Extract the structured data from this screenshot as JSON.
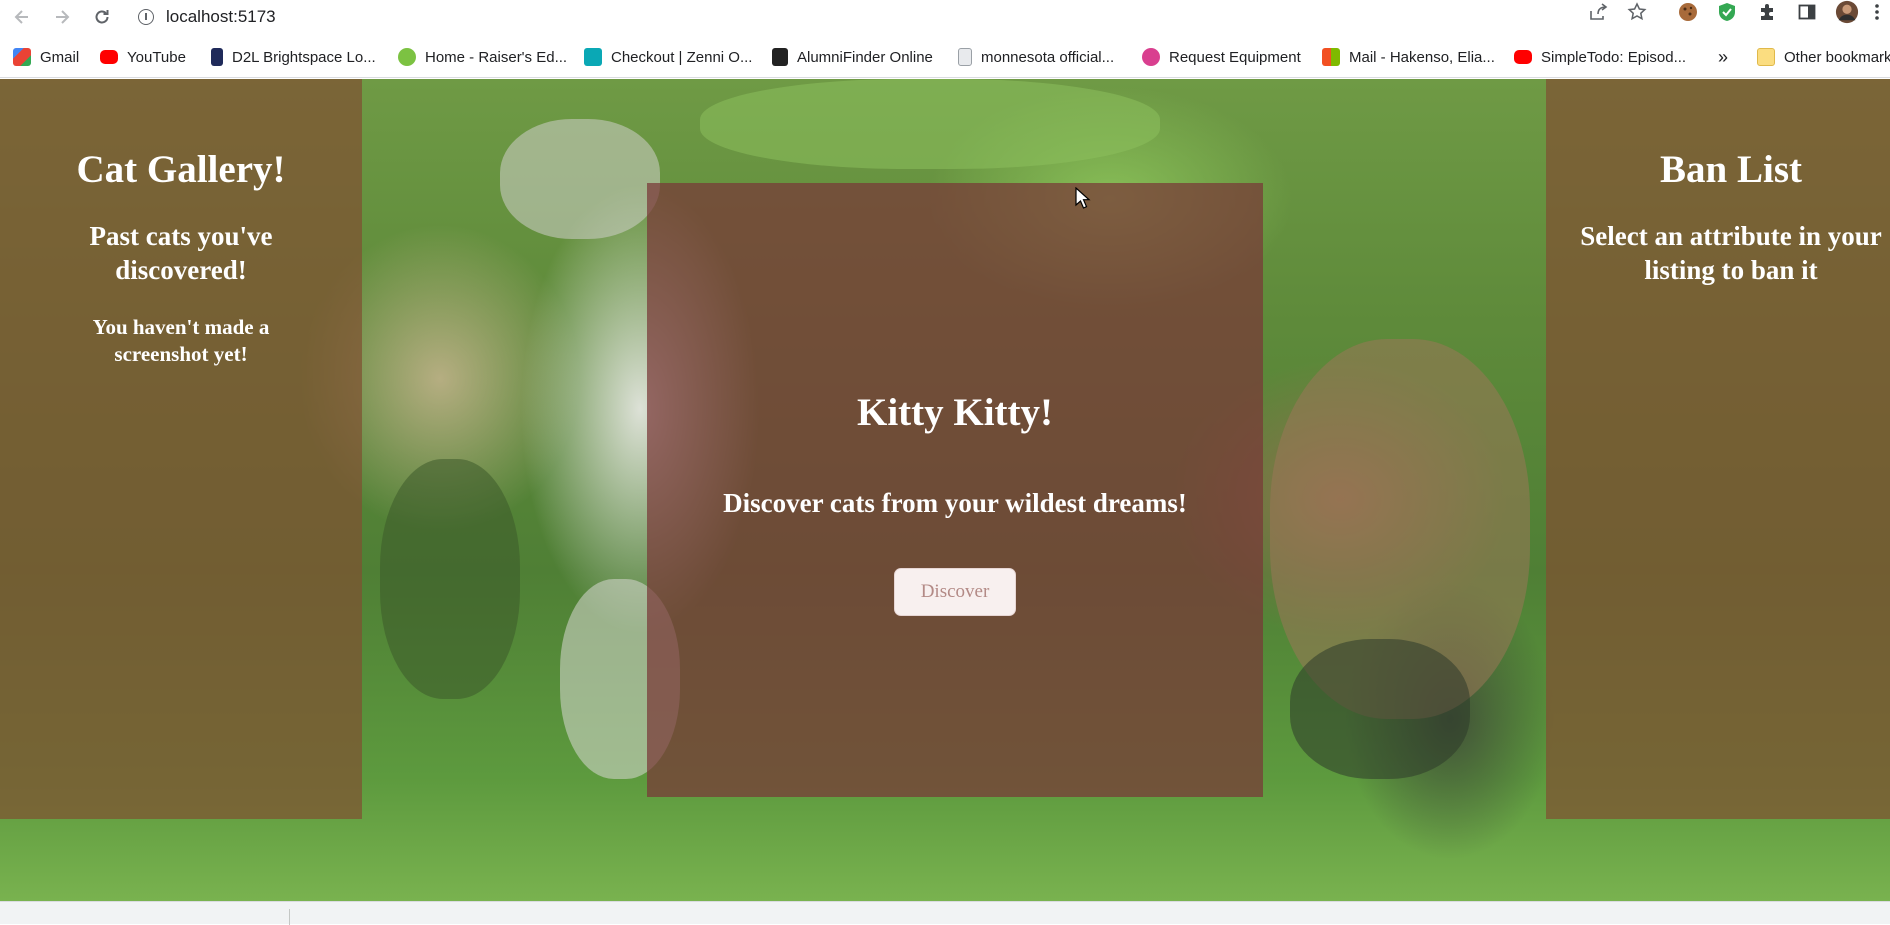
{
  "browser": {
    "url": "localhost:5173",
    "bookmarks": [
      {
        "label": "Gmail",
        "icon": "gmail-icon",
        "color": "#ea4335"
      },
      {
        "label": "YouTube",
        "icon": "youtube-icon",
        "color": "#ff0000"
      },
      {
        "label": "D2L Brightspace Lo...",
        "icon": "d2l-icon",
        "color": "#1f2a5a"
      },
      {
        "label": "Home - Raiser's Ed...",
        "icon": "raisers-edge-icon",
        "color": "#7cc242"
      },
      {
        "label": "Checkout | Zenni O...",
        "icon": "zenni-icon",
        "color": "#0aa8b5"
      },
      {
        "label": "AlumniFinder Online",
        "icon": "alumnifinder-icon",
        "color": "#222222"
      },
      {
        "label": "monnesota official...",
        "icon": "document-icon",
        "color": "#9aa0a6"
      },
      {
        "label": "Request Equipment",
        "icon": "cloud-icon",
        "color": "#d93f8f"
      },
      {
        "label": "Mail - Hakenso, Elia...",
        "icon": "microsoft-icon",
        "color": "#f25022"
      },
      {
        "label": "SimpleTodo: Episod...",
        "icon": "youtube-icon",
        "color": "#ff0000"
      }
    ],
    "overflow_label": "»",
    "other_bookmarks": "Other bookmarks"
  },
  "gallery": {
    "title": "Cat Gallery!",
    "subtitle": "Past cats you've discovered!",
    "empty_note": "You haven't made a screenshot yet!"
  },
  "main": {
    "title": "Kitty Kitty!",
    "subtitle": "Discover cats from your wildest dreams!",
    "button_label": "Discover"
  },
  "ban_list": {
    "title": "Ban List",
    "subtitle": "Select an attribute in your listing to ban it"
  },
  "colors": {
    "panel_side": "#805032",
    "panel_center": "#783737",
    "button_bg": "#f8f0ef",
    "button_text": "#b38a86"
  }
}
